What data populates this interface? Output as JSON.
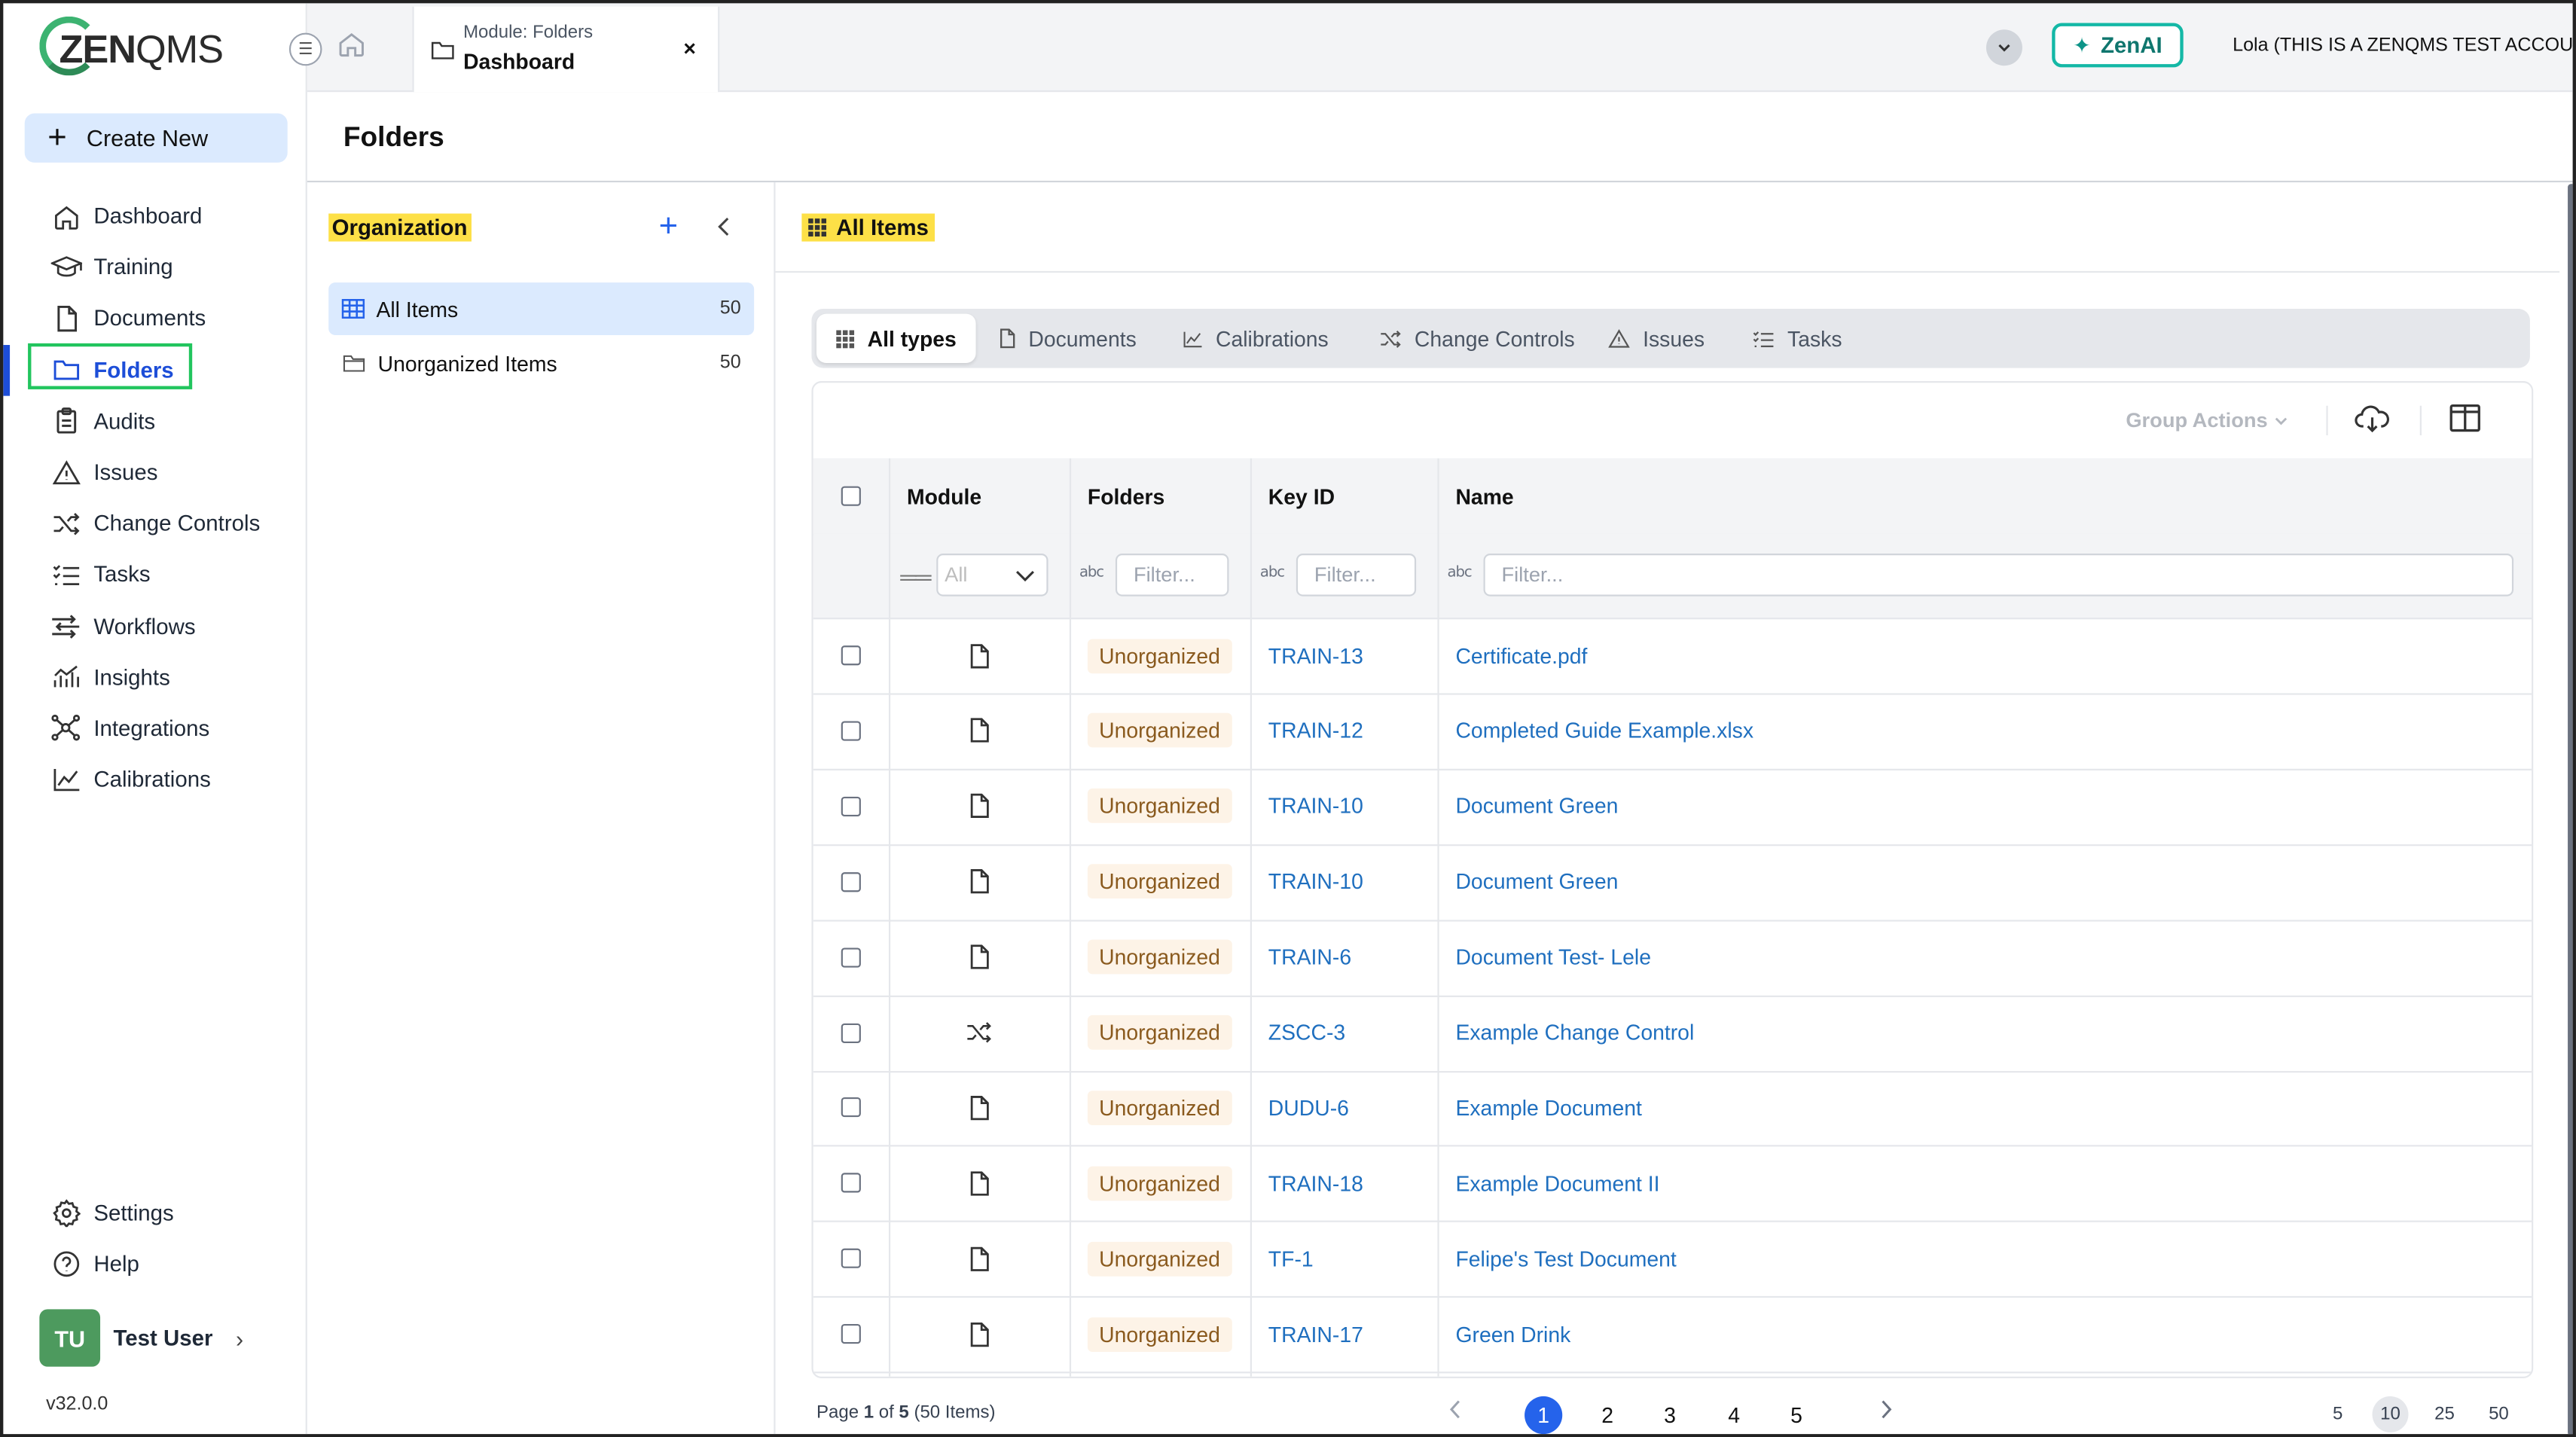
{
  "brand": {
    "logo_bold": "ZEN",
    "logo_thin": "QMS"
  },
  "sidebar": {
    "create_label": "Create New",
    "items": [
      {
        "label": "Dashboard",
        "icon": "home-icon"
      },
      {
        "label": "Training",
        "icon": "graduation-cap-icon"
      },
      {
        "label": "Documents",
        "icon": "document-icon"
      },
      {
        "label": "Folders",
        "icon": "folder-icon"
      },
      {
        "label": "Audits",
        "icon": "clipboard-icon"
      },
      {
        "label": "Issues",
        "icon": "warning-icon"
      },
      {
        "label": "Change Controls",
        "icon": "shuffle-icon"
      },
      {
        "label": "Tasks",
        "icon": "checklist-icon"
      },
      {
        "label": "Workflows",
        "icon": "workflow-icon"
      },
      {
        "label": "Insights",
        "icon": "bar-chart-icon"
      },
      {
        "label": "Integrations",
        "icon": "network-icon"
      },
      {
        "label": "Calibrations",
        "icon": "line-chart-icon"
      }
    ],
    "bottom": [
      {
        "label": "Settings",
        "icon": "gear-icon"
      },
      {
        "label": "Help",
        "icon": "help-icon"
      }
    ],
    "user": {
      "initials": "TU",
      "name": "Test User"
    },
    "version": "v32.0.0"
  },
  "topbar": {
    "tab_module": "Module: Folders",
    "tab_title": "Dashboard",
    "tab_close": "×",
    "zenai_label": "ZenAI",
    "account": "Lola (THIS IS A ZENQMS TEST ACCOUNT)"
  },
  "page": {
    "title": "Folders"
  },
  "org": {
    "title": "Organization",
    "items": [
      {
        "label": "All Items",
        "count": "50"
      },
      {
        "label": "Unorganized Items",
        "count": "50"
      }
    ]
  },
  "main": {
    "header": "All Items",
    "type_tabs": [
      "All types",
      "Documents",
      "Calibrations",
      "Change Controls",
      "Issues",
      "Tasks"
    ],
    "group_actions": "Group Actions",
    "columns": [
      "Module",
      "Folders",
      "Key ID",
      "Name"
    ],
    "filters": {
      "module_placeholder": "All",
      "text_placeholder": "Filter...",
      "abc": "abc"
    },
    "rows": [
      {
        "module": "document",
        "folder": "Unorganized",
        "key": "TRAIN-13",
        "name": "Certificate.pdf"
      },
      {
        "module": "document",
        "folder": "Unorganized",
        "key": "TRAIN-12",
        "name": "Completed Guide Example.xlsx"
      },
      {
        "module": "document",
        "folder": "Unorganized",
        "key": "TRAIN-10",
        "name": "Document Green"
      },
      {
        "module": "document",
        "folder": "Unorganized",
        "key": "TRAIN-10",
        "name": "Document Green"
      },
      {
        "module": "document",
        "folder": "Unorganized",
        "key": "TRAIN-6",
        "name": "Document Test- Lele"
      },
      {
        "module": "change-control",
        "folder": "Unorganized",
        "key": "ZSCC-3",
        "name": "Example Change Control"
      },
      {
        "module": "document",
        "folder": "Unorganized",
        "key": "DUDU-6",
        "name": "Example Document"
      },
      {
        "module": "document",
        "folder": "Unorganized",
        "key": "TRAIN-18",
        "name": "Example Document II"
      },
      {
        "module": "document",
        "folder": "Unorganized",
        "key": "TF-1",
        "name": "Felipe's Test Document"
      },
      {
        "module": "document",
        "folder": "Unorganized",
        "key": "TRAIN-17",
        "name": "Green Drink"
      }
    ],
    "pager": {
      "page_prefix": "Page ",
      "page_current": "1",
      "page_of": " of ",
      "page_total": "5",
      "items_note": " (50 Items)",
      "pages": [
        "1",
        "2",
        "3",
        "4",
        "5"
      ],
      "sizes": [
        "5",
        "10",
        "25",
        "50"
      ],
      "selected_size": "10"
    }
  },
  "colors": {
    "accent": "#2563eb",
    "highlight": "#fde047",
    "active_outline": "#22c55e",
    "zenai": "#14b8a6",
    "badge_bg": "#fdf3e7",
    "link": "#1f6fbf"
  }
}
